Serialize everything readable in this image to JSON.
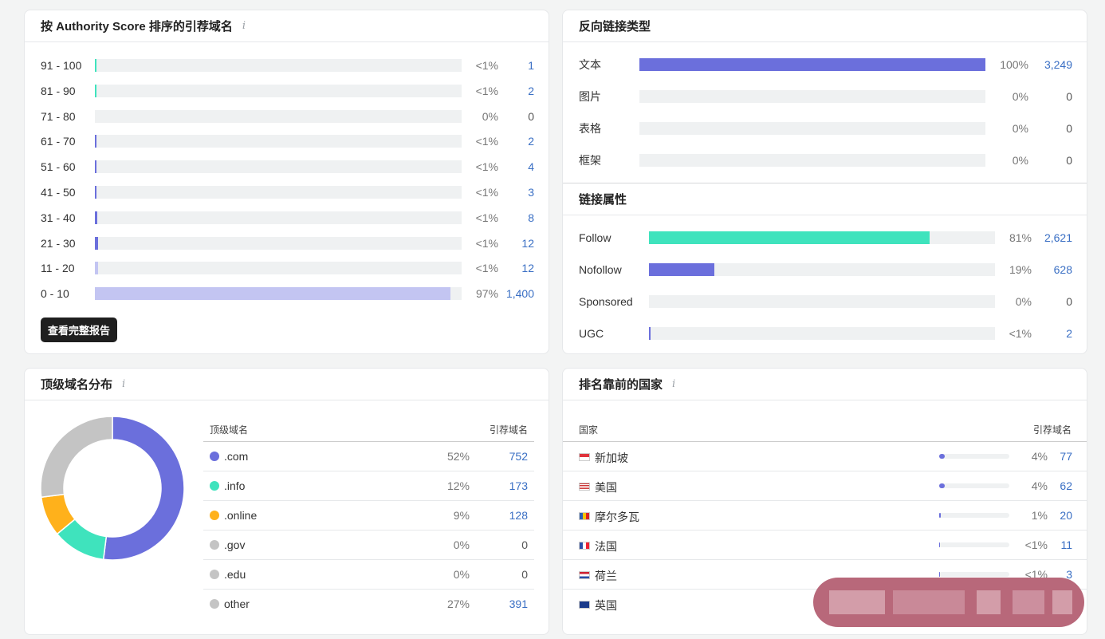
{
  "authority": {
    "title": "按 Authority Score 排序的引荐域名",
    "rows": [
      {
        "label": "91 - 100",
        "pct": "<1%",
        "count": "1",
        "frac": 0.004,
        "color": "#3fe3bd"
      },
      {
        "label": "81 - 90",
        "pct": "<1%",
        "count": "2",
        "frac": 0.004,
        "color": "#3fe3bd"
      },
      {
        "label": "71 - 80",
        "pct": "0%",
        "count": "0",
        "frac": 0,
        "color": "#3fe3bd"
      },
      {
        "label": "61 - 70",
        "pct": "<1%",
        "count": "2",
        "frac": 0.004,
        "color": "#6b6fdc"
      },
      {
        "label": "51 - 60",
        "pct": "<1%",
        "count": "4",
        "frac": 0.004,
        "color": "#6b6fdc"
      },
      {
        "label": "41 - 50",
        "pct": "<1%",
        "count": "3",
        "frac": 0.004,
        "color": "#6b6fdc"
      },
      {
        "label": "31 - 40",
        "pct": "<1%",
        "count": "8",
        "frac": 0.006,
        "color": "#6b6fdc"
      },
      {
        "label": "21 - 30",
        "pct": "<1%",
        "count": "12",
        "frac": 0.008,
        "color": "#6b6fdc"
      },
      {
        "label": "11 - 20",
        "pct": "<1%",
        "count": "12",
        "frac": 0.008,
        "color": "#c3c5f2"
      },
      {
        "label": "0 - 10",
        "pct": "97%",
        "count": "1,400",
        "frac": 0.97,
        "color": "#c3c5f2"
      }
    ],
    "button": "查看完整报告"
  },
  "backlink_types": {
    "title": "反向链接类型",
    "rows": [
      {
        "label": "文本",
        "pct": "100%",
        "count": "3,249",
        "frac": 1.0,
        "color": "#6b6fdc"
      },
      {
        "label": "图片",
        "pct": "0%",
        "count": "0",
        "frac": 0,
        "color": "#6b6fdc"
      },
      {
        "label": "表格",
        "pct": "0%",
        "count": "0",
        "frac": 0,
        "color": "#6b6fdc"
      },
      {
        "label": "框架",
        "pct": "0%",
        "count": "0",
        "frac": 0,
        "color": "#6b6fdc"
      }
    ]
  },
  "link_attributes": {
    "title": "链接属性",
    "rows": [
      {
        "label": "Follow",
        "pct": "81%",
        "count": "2,621",
        "frac": 0.81,
        "color": "#3fe3bd"
      },
      {
        "label": "Nofollow",
        "pct": "19%",
        "count": "628",
        "frac": 0.19,
        "color": "#6b6fdc"
      },
      {
        "label": "Sponsored",
        "pct": "0%",
        "count": "0",
        "frac": 0,
        "color": "#6b6fdc"
      },
      {
        "label": "UGC",
        "pct": "<1%",
        "count": "2",
        "frac": 0.004,
        "color": "#6b6fdc"
      }
    ]
  },
  "tld": {
    "title": "顶级域名分布",
    "col_name": "顶级域名",
    "col_count": "引荐域名",
    "rows": [
      {
        "name": ".com",
        "pct": "52%",
        "count": "752",
        "share": 52,
        "color": "#6b6fdc"
      },
      {
        "name": ".info",
        "pct": "12%",
        "count": "173",
        "share": 12,
        "color": "#3fe3bd"
      },
      {
        "name": ".online",
        "pct": "9%",
        "count": "128",
        "share": 9,
        "color": "#ffb11b"
      },
      {
        "name": ".gov",
        "pct": "0%",
        "count": "0",
        "share": 0,
        "color": "#c4c4c4"
      },
      {
        "name": ".edu",
        "pct": "0%",
        "count": "0",
        "share": 0,
        "color": "#c4c4c4"
      },
      {
        "name": "other",
        "pct": "27%",
        "count": "391",
        "share": 27,
        "color": "#c4c4c4"
      }
    ]
  },
  "countries": {
    "title": "排名靠前的国家",
    "col_name": "国家",
    "col_count": "引荐域名",
    "rows": [
      {
        "name": "新加坡",
        "pct": "4%",
        "count": "77",
        "frac": 0.04,
        "flag": "sg-flag-icon"
      },
      {
        "name": "美国",
        "pct": "4%",
        "count": "62",
        "frac": 0.04,
        "flag": "us-flag-icon"
      },
      {
        "name": "摩尔多瓦",
        "pct": "1%",
        "count": "20",
        "frac": 0.01,
        "flag": "md-flag-icon"
      },
      {
        "name": "法国",
        "pct": "<1%",
        "count": "11",
        "frac": 0.005,
        "flag": "fr-flag-icon"
      },
      {
        "name": "荷兰",
        "pct": "<1%",
        "count": "3",
        "frac": 0.005,
        "flag": "nl-flag-icon"
      },
      {
        "name": "英国",
        "pct": "",
        "count": "",
        "frac": 0,
        "flag": "gb-flag-icon"
      }
    ]
  }
}
